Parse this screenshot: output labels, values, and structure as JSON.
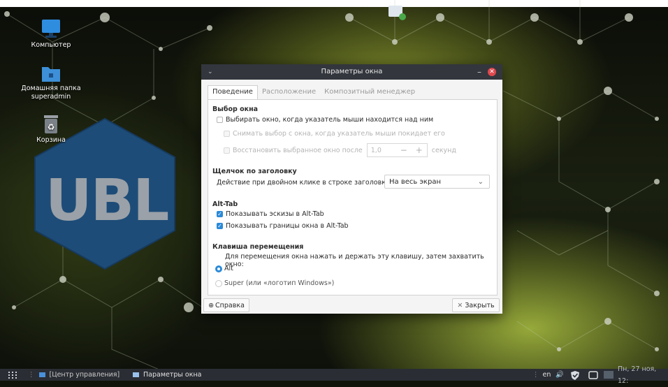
{
  "desktop": {
    "icons": [
      {
        "label": "Компьютер",
        "icon": "monitor-icon"
      },
      {
        "label": "Домашняя папка superadmin",
        "icon": "home-folder-icon"
      },
      {
        "label": "Корзина",
        "icon": "trash-icon"
      }
    ],
    "logo_text": "UBL"
  },
  "window": {
    "title": "Параметры окна",
    "tabs": [
      {
        "label": "Поведение",
        "active": true
      },
      {
        "label": "Расположение",
        "active": false
      },
      {
        "label": "Композитный менеджер",
        "active": false
      }
    ],
    "focus": {
      "title": "Выбор окна",
      "hover_select": {
        "label": "Выбирать окно, когда указатель мыши находится над ним",
        "checked": false
      },
      "unselect_on_leave": {
        "label": "Снимать выбор с окна, когда указатель мыши покидает его",
        "checked": false,
        "enabled": false
      },
      "restore_after": {
        "label": "Восстановить выбранное окно после",
        "value": "1,0",
        "unit": "секунд",
        "checked": false,
        "enabled": false
      }
    },
    "titlebar_click": {
      "title": "Щелчок по заголовку",
      "label": "Действие при двойном клике в строке заголовка:",
      "value": "На весь экран"
    },
    "alttab": {
      "title": "Alt-Tab",
      "thumbnails": {
        "label": "Показывать эскизы в Alt-Tab",
        "checked": true
      },
      "borders": {
        "label": "Показывать границы окна в Alt-Tab",
        "checked": true
      }
    },
    "move_key": {
      "title": "Клавиша перемещения",
      "description": "Для перемещения окна нажать и держать эту клавишу, затем захватить окно:",
      "options": [
        {
          "label": "Alt",
          "selected": true
        },
        {
          "label": "Super (или «логотип Windows»)",
          "selected": false
        }
      ]
    },
    "help_label": "Справка",
    "close_label": "Закрыть"
  },
  "taskbar": {
    "items": [
      {
        "label": "[Центр управления]"
      },
      {
        "label": "Параметры окна"
      }
    ],
    "tray": {
      "lang": "en",
      "datetime": "Пн, 27 ноя, 12:"
    }
  },
  "colors": {
    "accent": "#2a8ad8",
    "titlebar": "#33363d",
    "taskbar": "#2a2d33",
    "close": "#e0484e"
  }
}
